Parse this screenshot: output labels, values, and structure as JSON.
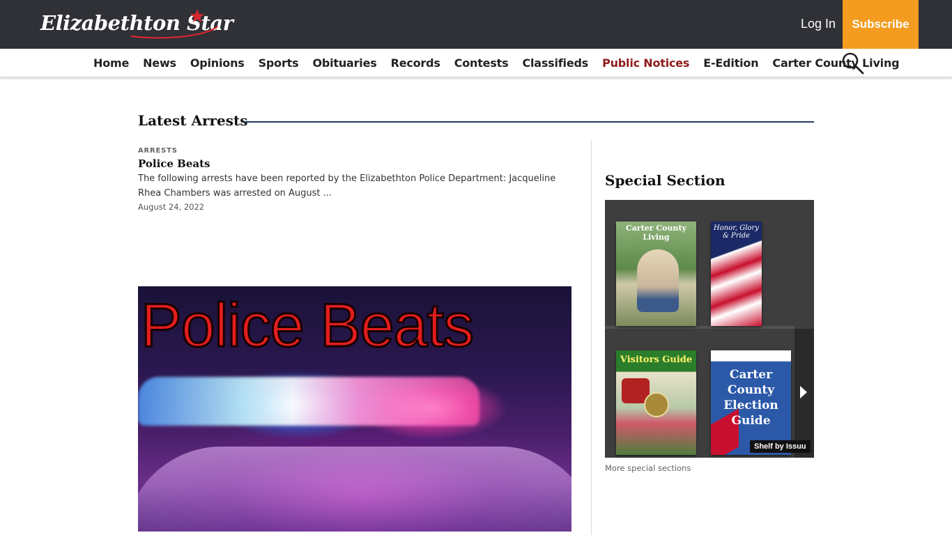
{
  "header": {
    "logo_text": "Elizabethton Star",
    "login_label": "Log In",
    "subscribe_label": "Subscribe",
    "accent_color": "#f39c1f"
  },
  "nav": {
    "items": [
      {
        "label": "Home"
      },
      {
        "label": "News"
      },
      {
        "label": "Opinions"
      },
      {
        "label": "Sports"
      },
      {
        "label": "Obituaries"
      },
      {
        "label": "Records"
      },
      {
        "label": "Contests"
      },
      {
        "label": "Classifieds"
      },
      {
        "label": "Public Notices",
        "highlight": true
      },
      {
        "label": "E-Edition"
      },
      {
        "label": "Carter County Living"
      }
    ],
    "highlight_color": "#8e1b1b",
    "search_icon": "search-icon"
  },
  "main": {
    "section_title": "Latest Arrests",
    "article": {
      "kicker": "ARRESTS",
      "headline": "Police Beats",
      "excerpt": "The following arrests have been reported by the Elizabethton Police Department: Jacqueline Rhea Chambers was arrested on August ...",
      "date": "August 24, 2022",
      "image_caption": "Police Beats"
    }
  },
  "sidebar": {
    "title": "Special Section",
    "covers": [
      {
        "title": "Carter County Living"
      },
      {
        "title": "Honor, Glory & Pride"
      },
      {
        "title": "Visitors Guide"
      },
      {
        "title": "Carter County Election Guide"
      }
    ],
    "shelf_badge": "Shelf by Issuu",
    "more_link": "More special sections"
  }
}
